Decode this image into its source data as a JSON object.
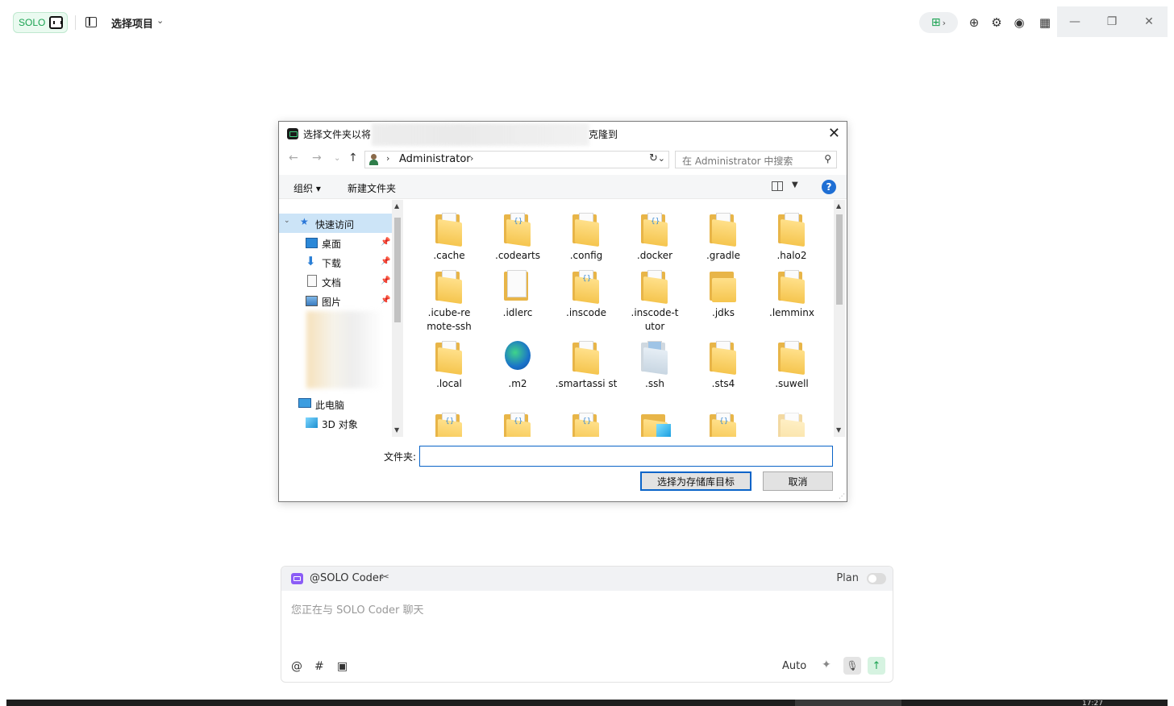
{
  "app": {
    "badge_text": "SOLO",
    "project_selector": "选择项目",
    "accent": "#1aa251"
  },
  "dialog": {
    "title_prefix": "选择文件夹以将",
    "title_suffix": "克隆到",
    "address": "Administrator",
    "search_placeholder": "在 Administrator 中搜索",
    "organize": "组织",
    "new_folder": "新建文件夹",
    "nav": {
      "quick_access": "快速访问",
      "desktop": "桌面",
      "downloads": "下载",
      "documents": "文档",
      "pictures": "图片",
      "this_pc": "此电脑",
      "objects_3d": "3D 对象"
    },
    "files": [
      ".cache",
      ".codearts",
      ".config",
      ".docker",
      ".gradle",
      ".halo2",
      ".icube-re mote-ssh",
      ".idlerc",
      ".inscode",
      ".inscode-t utor",
      ".jdks",
      ".lemminx",
      ".local",
      ".m2",
      ".smartassi st",
      ".ssh",
      ".sts4",
      ".suwell"
    ],
    "folder_label": "文件夹:",
    "folder_value": "",
    "ok_button": "选择为存储库目标",
    "cancel_button": "取消"
  },
  "chat": {
    "agent": "@SOLO Coder",
    "plan_label": "Plan",
    "placeholder": "您正在与 SOLO Coder 聊天",
    "mode": "Auto"
  },
  "taskbar": {
    "clock": "17:27"
  }
}
